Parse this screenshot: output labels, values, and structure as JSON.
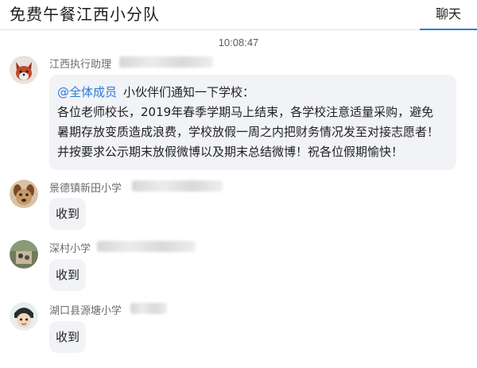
{
  "header": {
    "title": "免费午餐江西小分队",
    "tab_label": "聊天",
    "accent_color": "#2f7bd8"
  },
  "chat": {
    "timestamp": "10:08:47",
    "messages": [
      {
        "sender": "江西执行助理",
        "avatar": "fox-avatar",
        "mention": "@全体成员",
        "lines": [
          "小伙伴们通知一下学校：",
          "各位老师校长，2019年春季学期马上结束，各学校注意适量采购，避免",
          "暑期存放变质造成浪费，学校放假一周之内把财务情况发至对接志愿者！",
          "并按要求公示期末放假微博以及期末总结微博！祝各位假期愉快！"
        ]
      },
      {
        "sender": "景德镇新田小学",
        "avatar": "dog-avatar",
        "text": "收到"
      },
      {
        "sender": "深村小学",
        "avatar": "photo-avatar",
        "text": "收到"
      },
      {
        "sender": "湖口县源塘小学",
        "avatar": "cartoon-avatar",
        "text": "收到"
      }
    ]
  }
}
